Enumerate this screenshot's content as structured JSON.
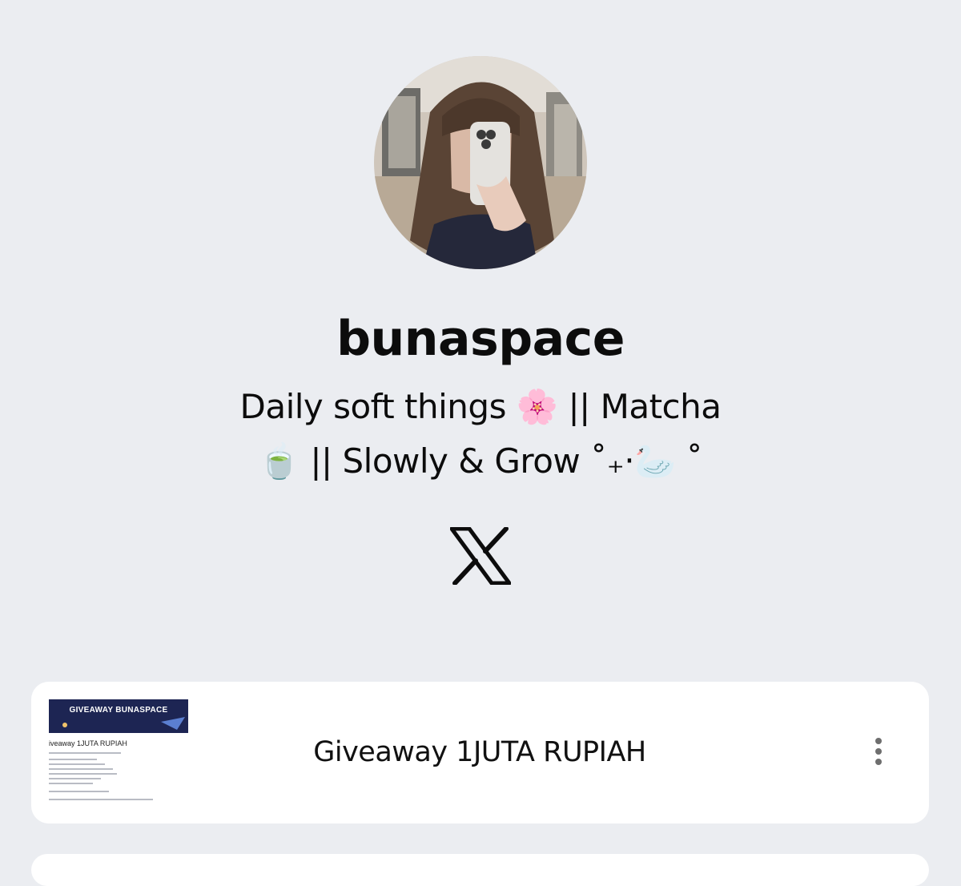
{
  "profile": {
    "username": "bunaspace",
    "bio_line1": "Daily soft things 🌸 || Matcha",
    "bio_line2": "🍵 || Slowly & Grow ˚₊‧🦢 ˚",
    "avatar_icon": "profile-photo"
  },
  "social": {
    "x_icon": "x-logo-icon"
  },
  "links": [
    {
      "title": "Giveaway 1JUTA RUPIAH",
      "thumbnail_banner": "GIVEAWAY BUNASPACE",
      "thumbnail_heading": "iveaway 1JUTA RUPIAH",
      "menu_icon": "more-vertical-icon"
    }
  ],
  "colors": {
    "background": "#ebedf1",
    "card": "#ffffff",
    "text": "#0c0c0c",
    "thumb_banner": "#1d2553"
  }
}
